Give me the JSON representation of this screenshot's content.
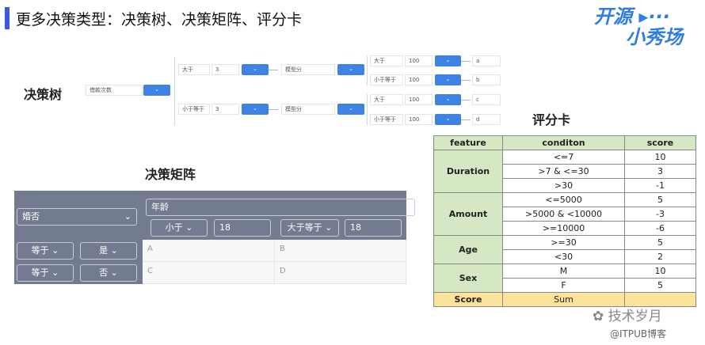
{
  "header": {
    "title": "更多决策类型：决策树、决策矩阵、评分卡"
  },
  "logo": {
    "line1": "开源",
    "line2": "小秀场"
  },
  "tree": {
    "label": "决策树",
    "root": "借款次数",
    "branches": [
      {
        "op": "大于",
        "value": "3",
        "model": "模型分",
        "leaves": [
          {
            "op": "大于",
            "value": "100",
            "result": "a"
          },
          {
            "op": "小于等于",
            "value": "100",
            "result": "b"
          }
        ]
      },
      {
        "op": "小于等于",
        "value": "3",
        "model": "模型分",
        "leaves": [
          {
            "op": "大于",
            "value": "100",
            "result": "c"
          },
          {
            "op": "小于等于",
            "value": "100",
            "result": "d"
          }
        ]
      }
    ]
  },
  "matrix": {
    "label": "决策矩阵",
    "row_field": "婚否",
    "col_field": "年龄",
    "cols": [
      {
        "op": "小于",
        "value": "18"
      },
      {
        "op": "大于等于",
        "value": "18"
      }
    ],
    "rows": [
      {
        "op": "等于",
        "value": "是",
        "cells": [
          "A",
          "B"
        ]
      },
      {
        "op": "等于",
        "value": "否",
        "cells": [
          "C",
          "D"
        ]
      }
    ]
  },
  "scorecard": {
    "label": "评分卡",
    "headers": [
      "feature",
      "conditon",
      "score"
    ],
    "groups": [
      {
        "feature": "Duration",
        "rows": [
          [
            "<=7",
            "10"
          ],
          [
            ">7 & <=30",
            "3"
          ],
          [
            ">30",
            "-1"
          ]
        ]
      },
      {
        "feature": "Amount",
        "rows": [
          [
            "<=5000",
            "5"
          ],
          [
            ">5000 & <10000",
            "-3"
          ],
          [
            ">=10000",
            "-6"
          ]
        ]
      },
      {
        "feature": "Age",
        "rows": [
          [
            ">=30",
            "5"
          ],
          [
            "<30",
            "2"
          ]
        ]
      },
      {
        "feature": "Sex",
        "rows": [
          [
            "M",
            "10"
          ],
          [
            "F",
            "5"
          ]
        ]
      }
    ],
    "total": [
      "Score",
      "Sum",
      ""
    ]
  },
  "watermark": {
    "wechat": "技术岁月",
    "site": "@ITPUB博客"
  }
}
